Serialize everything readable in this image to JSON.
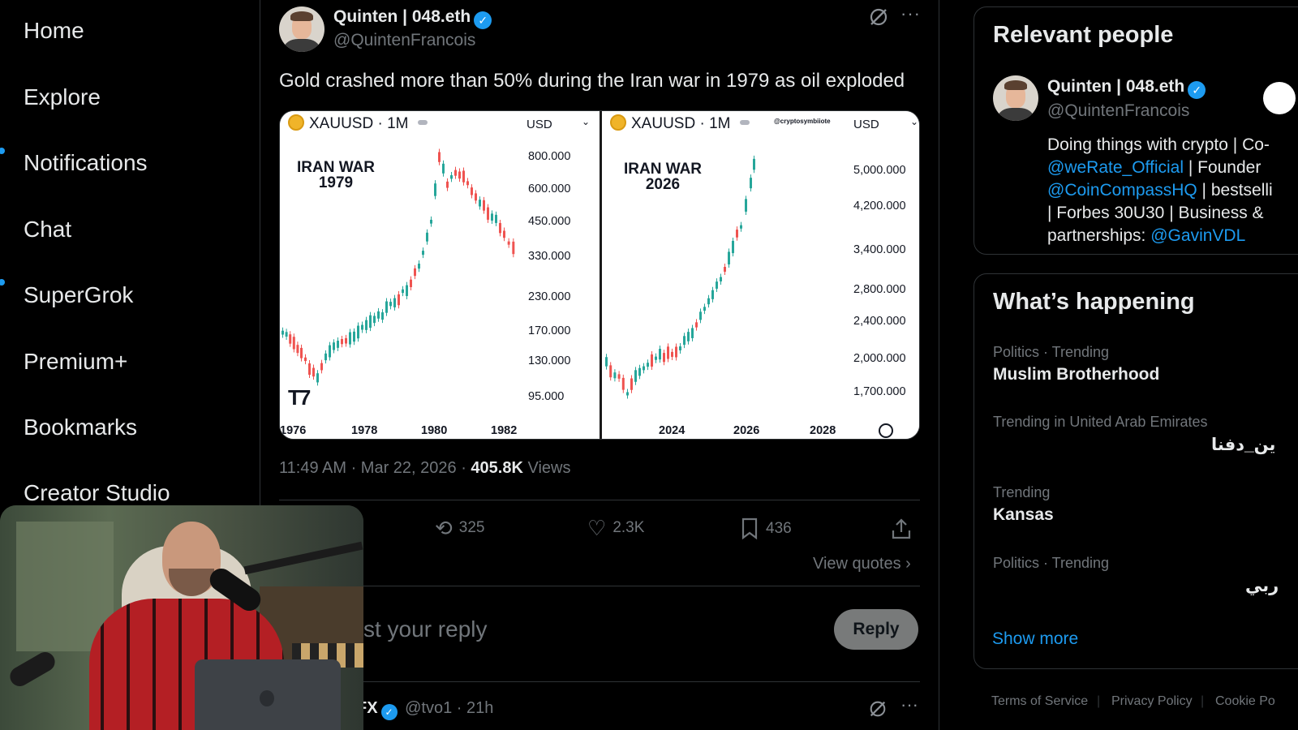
{
  "nav": {
    "items": [
      {
        "label": "Home",
        "dot": false
      },
      {
        "label": "Explore",
        "dot": false
      },
      {
        "label": "Notifications",
        "dot": true
      },
      {
        "label": "Chat",
        "dot": false
      },
      {
        "label": "SuperGrok",
        "dot": true
      },
      {
        "label": "Premium+",
        "dot": false
      },
      {
        "label": "Bookmarks",
        "dot": false
      },
      {
        "label": "Creator Studio",
        "dot": false
      }
    ]
  },
  "tweet": {
    "author_name": "Quinten | 048.eth",
    "author_handle": "@QuintenFrancois",
    "verified_icon": "verified-badge-icon",
    "text": "Gold crashed more than 50% during the Iran war in 1979 as oil exploded",
    "meta_time": "11:49 AM · Mar 22, 2026 · ",
    "meta_views_count": "405.8K",
    "meta_views_label": " Views",
    "actions": {
      "repost_count": "325",
      "like_count": "2.3K",
      "bookmark_count": "436"
    },
    "view_quotes": "View quotes",
    "view_quotes_icon": "chevron-right-icon",
    "reply_placeholder": "st your reply",
    "reply_button": "Reply",
    "next_author": "FX",
    "next_handle": "@tvo1 · 21h"
  },
  "charts": {
    "left": {
      "symbol": "XAUUSD · 1M",
      "currency": "USD",
      "title_line1": "IRAN WAR",
      "title_line2": "1979",
      "y_ticks": [
        "800.000",
        "600.000",
        "450.000",
        "330.000",
        "230.000",
        "170.000",
        "130.000",
        "95.000"
      ],
      "x_ticks": [
        "1976",
        "1978",
        "1980",
        "1982"
      ],
      "logo": "TV"
    },
    "right": {
      "symbol": "XAUUSD · 1M",
      "currency": "USD",
      "watermark": "@cryptosymbiiote",
      "title_line1": "IRAN WAR",
      "title_line2": "2026",
      "y_ticks": [
        "5,000.000",
        "4,200.000",
        "3,400.000",
        "2,800.000",
        "2,400.000",
        "2,000.000",
        "1,700.000"
      ],
      "x_ticks": [
        "2024",
        "2026",
        "2028"
      ]
    }
  },
  "right": {
    "relevant_title": "Relevant people",
    "person_name": "Quinten | 048.eth",
    "person_handle": "@QuintenFrancois",
    "bio_line1": "Doing things with crypto | Co-",
    "bio_link1": "@weRate_Official",
    "bio_line2_rest": " | Founder",
    "bio_link2": "@CoinCompassHQ",
    "bio_line3_rest": " | bestselli",
    "bio_line4": "| Forbes 30U30 | Business &",
    "bio_line5_pre": "partnerships: ",
    "bio_link3": "@GavinVDL",
    "happening_title": "What’s happening",
    "trends": [
      {
        "category": "Politics · Trending",
        "name": "Muslim Brotherhood"
      },
      {
        "category": "Trending in United Arab Emirates",
        "name": "ين_دفنا"
      },
      {
        "category": "Trending",
        "name": "Kansas"
      },
      {
        "category": "Politics · Trending",
        "name": "ربي"
      }
    ],
    "show_more": "Show more",
    "footer": [
      "Terms of Service",
      "Privacy Policy",
      "Cookie Po"
    ]
  }
}
